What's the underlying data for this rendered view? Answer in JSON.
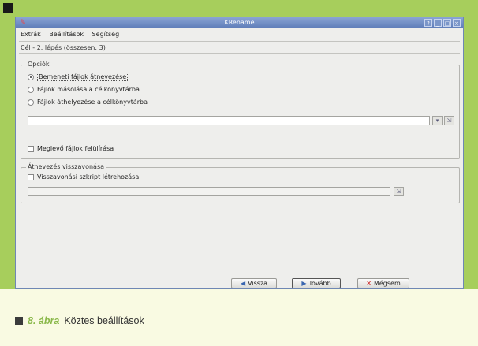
{
  "window": {
    "title": "KRename",
    "controls": [
      "?",
      "_",
      "□",
      "×"
    ]
  },
  "menu": [
    "Extrák",
    "Beállítások",
    "Segítség"
  ],
  "step_label": "Cél - 2. lépés (összesen: 3)",
  "options": {
    "legend": "Opciók",
    "radio_rename": "Bemeneti fájlok átnevezése",
    "radio_copy": "Fájlok másolása a célkönyvtárba",
    "radio_move": "Fájlok áthelyezése a célkönyvtárba",
    "selected": "radio_rename",
    "overwrite_label": "Meglevő fájlok felülírása"
  },
  "undo": {
    "legend": "Átnevezés visszavonása",
    "script_label": "Visszavonási szkript létrehozása"
  },
  "buttons": {
    "back": "Vissza",
    "next": "Tovább",
    "cancel": "Mégsem"
  },
  "caption": {
    "number": "8. ábra",
    "text": "Köztes beállítások"
  },
  "colors": {
    "frame_green": "#a7ce5c",
    "page_bg": "#f9fae2",
    "titlebar": "#5d7cb8"
  }
}
